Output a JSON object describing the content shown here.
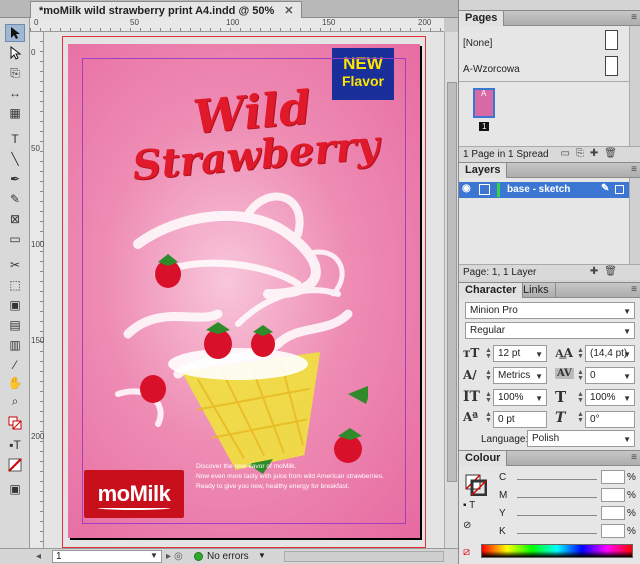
{
  "document": {
    "tab_title": "*moMilk wild strawberry print A4.indd @ 50%",
    "ruler_labels": [
      "0",
      "50",
      "100",
      "150",
      "200"
    ],
    "artwork": {
      "badge_line1": "NEW",
      "badge_line2": "Flavor",
      "headline_line1": "Wild",
      "headline_line2": "Strawberry",
      "logo": "moMilk",
      "tagline": [
        "Discover the new flavor of moMilk.",
        "Now even more tasty with juice from wild American strawberries.",
        "Ready to give you new, healthy energy for breakfast."
      ]
    }
  },
  "statusbar": {
    "page": "1",
    "preflight_status": "No errors"
  },
  "pages_panel": {
    "tab": "Pages",
    "masters": [
      "[None]",
      "A-Wzorcowa"
    ],
    "page_label": "A",
    "page_number": "1",
    "footer": "1 Page in 1 Spread"
  },
  "layers_panel": {
    "tab": "Layers",
    "layer_name": "base - sketch",
    "footer": "Page: 1, 1 Layer"
  },
  "character_panel": {
    "tab_active": "Character",
    "tab_inactive": "Links",
    "font_family": "Minion Pro",
    "font_style": "Regular",
    "font_size": "12 pt",
    "leading": "(14,4 pt)",
    "kerning": "Metrics",
    "tracking": "0",
    "vertical_scale": "100%",
    "horizontal_scale": "100%",
    "baseline_shift": "0 pt",
    "skew": "0°",
    "language_label": "Language:",
    "language": "Polish"
  },
  "colour_panel": {
    "tab": "Colour",
    "channels": [
      "C",
      "M",
      "Y",
      "K"
    ],
    "pct": "%"
  },
  "colors": {
    "selection": "#3b77d2",
    "page_bg": "#e66aa0",
    "headline": "#e01a2a",
    "badge_bg": "#1a2f9a",
    "badge_text": "#ffe400",
    "logo_bg": "#c8101c",
    "preflight_ok": "#2eaa2e"
  }
}
